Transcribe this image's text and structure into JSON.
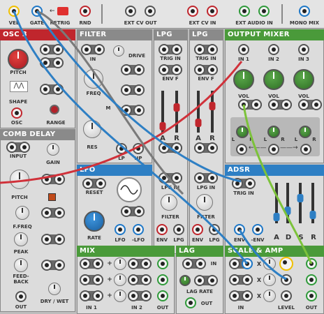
{
  "topbar": {
    "vel": "VEL",
    "gate": "GATE",
    "retrig": "RETRIG",
    "rnd": "RND",
    "ext_cv_out": "EXT CV OUT",
    "ext_cv_in": "EXT CV IN",
    "ext_audio_in": "EXT AUDIO IN",
    "mono_mix": "MONO MIX"
  },
  "osc3": {
    "title": "OSC 3",
    "pitch": "PITCH",
    "shape": "SHAPE",
    "osc": "OSC",
    "range": "RANGE"
  },
  "comb": {
    "title": "COMB DELAY",
    "input": "INPUT",
    "gain": "GAIN",
    "pitch": "PITCH",
    "ffreq": "F.FREQ",
    "peak": "PEAK",
    "feedback1": "FEED-",
    "feedback2": "BACK",
    "out": "OUT",
    "drywet": "DRY / WET"
  },
  "filter": {
    "title": "FILTER",
    "in": "IN",
    "drive": "DRIVE",
    "freq": "FREQ",
    "res": "RES",
    "m": "M",
    "lp": "LP",
    "hp": "HP"
  },
  "lpg1": {
    "title": "LPG",
    "trig": "TRIG IN",
    "envf": "ENV F",
    "a": "A",
    "r": "R",
    "lpgin": "LPG IN",
    "filter": "FILTER",
    "env": "ENV",
    "lpg": "LPG"
  },
  "lpg2": {
    "title": "LPG",
    "trig": "TRIG IN",
    "envf": "ENV F",
    "a": "A",
    "r": "R",
    "lpgin": "LPG IN",
    "filter": "FILTER",
    "env": "ENV",
    "lpg": "LPG"
  },
  "lfo": {
    "title": "LFO",
    "reset": "RESET",
    "rate": "RATE",
    "lfo": "LFO",
    "neglfo": "-LFO"
  },
  "outmix": {
    "title": "OUTPUT MIXER",
    "in1": "IN 1",
    "in2": "IN 2",
    "in3": "IN 3",
    "vol": "VOL",
    "l": "L",
    "r": "R"
  },
  "adsr": {
    "title": "ADSR",
    "trig": "TRIG IN",
    "env": "ENV",
    "negenv": "-ENV",
    "a": "A",
    "d": "D",
    "s": "S",
    "r": "R"
  },
  "mix": {
    "title": "MIX",
    "in1": "IN 1",
    "in2": "IN 2",
    "out": "OUT"
  },
  "lag": {
    "title": "LAG",
    "in": "IN",
    "rate": "LAG RATE",
    "out": "OUT"
  },
  "scale": {
    "title": "SCALE & AMP",
    "in": "IN",
    "level": "LEVEL",
    "out": "OUT",
    "x": "X"
  },
  "colors": {
    "red": "#c0262d",
    "grey": "#7a7a7a",
    "blue": "#2e7fc4",
    "green": "#4a9a3a"
  }
}
